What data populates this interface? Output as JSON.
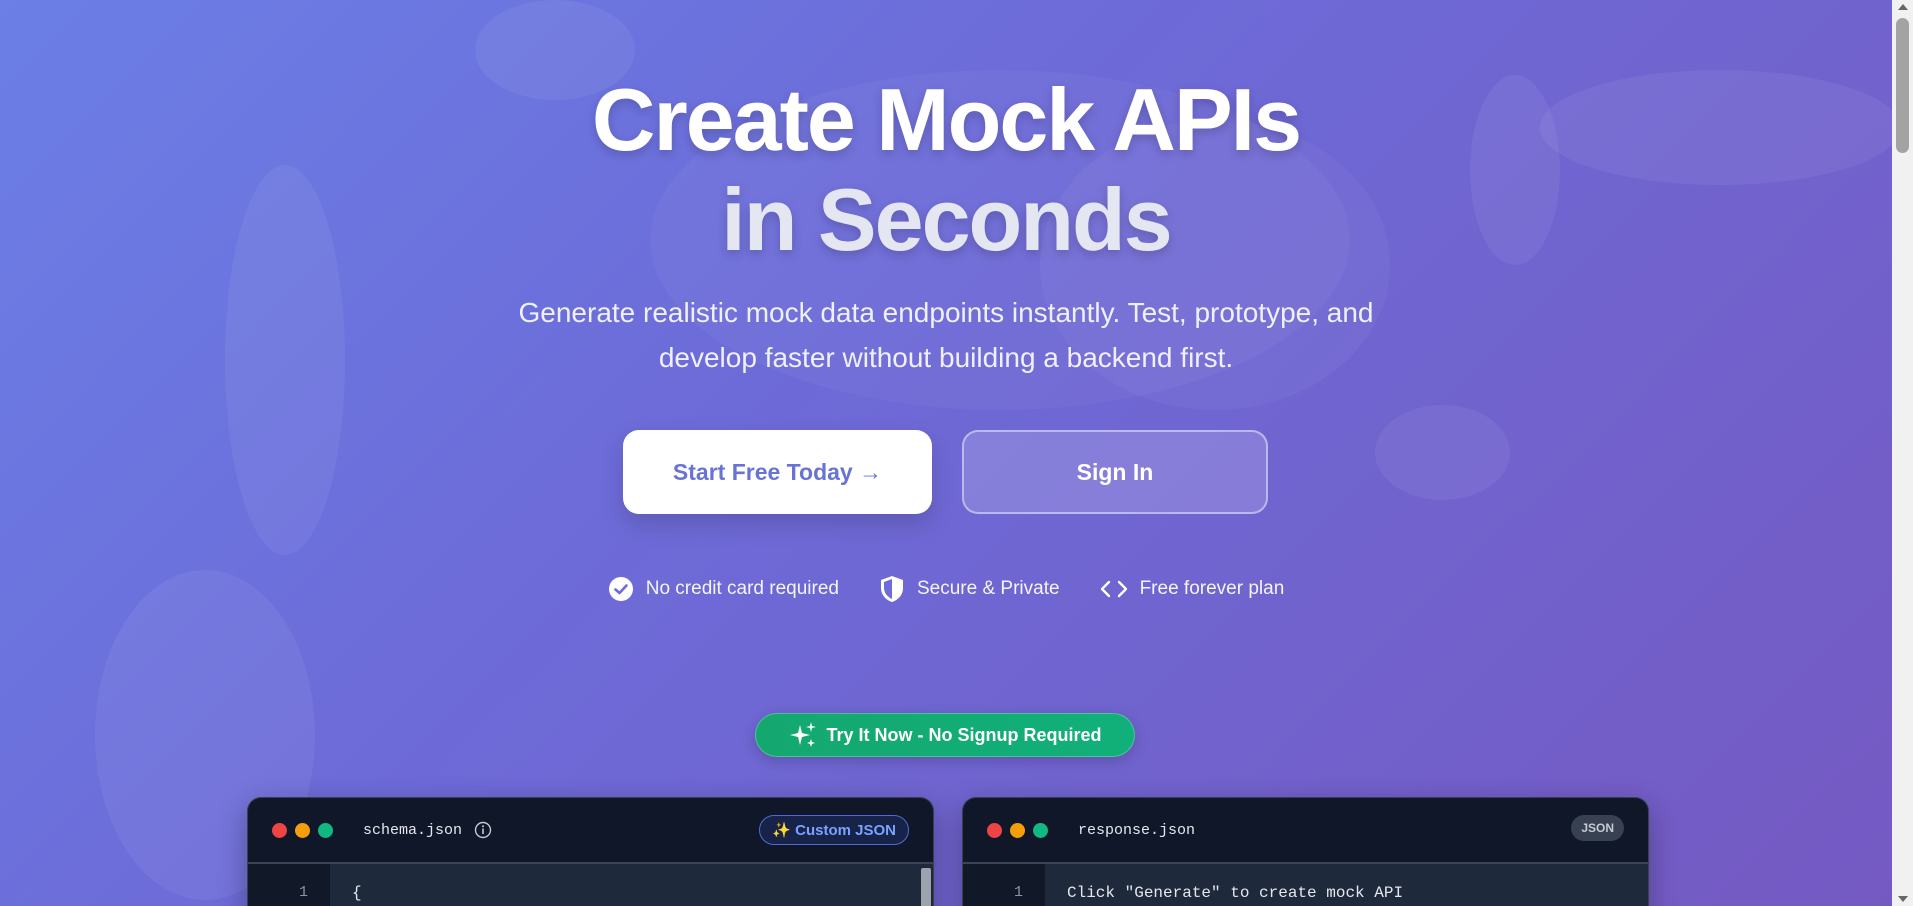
{
  "hero": {
    "title_line1": "Create Mock APIs",
    "title_line2": "in Seconds",
    "subtitle_line1": "Generate realistic mock data endpoints instantly. Test, prototype, and",
    "subtitle_line2": "develop faster without building a backend first."
  },
  "actions": {
    "primary_label": "Start Free Today →",
    "secondary_label": "Sign In"
  },
  "features": [
    {
      "icon": "check-circle-icon",
      "label": "No credit card required"
    },
    {
      "icon": "shield-icon",
      "label": "Secure & Private"
    },
    {
      "icon": "code-icon",
      "label": "Free forever plan"
    }
  ],
  "try_now": {
    "icon": "sparkles-icon",
    "label": "Try It Now - No Signup Required"
  },
  "schema_panel": {
    "filename": "schema.json",
    "badge": "✨ Custom JSON",
    "line_numbers": [
      "1"
    ],
    "lines": [
      "{"
    ]
  },
  "response_panel": {
    "filename": "response.json",
    "badge": "JSON",
    "line_numbers": [
      "1"
    ],
    "lines": [
      "Click \"Generate\" to create mock API"
    ]
  },
  "colors": {
    "primary_text": "#6774d6",
    "try_button": "#12ab73",
    "editor_bg": "#0f1729"
  }
}
